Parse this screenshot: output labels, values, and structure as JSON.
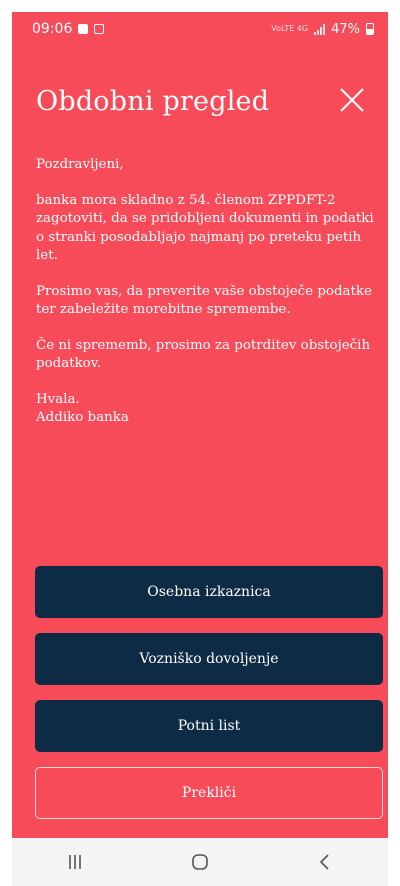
{
  "status_bar": {
    "time": "09:06",
    "network": "VoLTE 4G",
    "battery_percent": "47%"
  },
  "dialog": {
    "title": "Obdobni pregled",
    "paragraphs": [
      "Pozdravljeni,",
      "banka mora skladno z 54. členom ZPPDFT-2 zagotoviti, da se pridobljeni dokumenti in podatki o stranki posodabljajo najmanj po preteku petih let.",
      "Prosimo vas, da preverite vaše obstoječe podatke ter zabeležite morebitne spremembe.",
      "Če ni sprememb, prosimo za potrditev obstoječih podatkov."
    ],
    "closing_line1": "Hvala.",
    "closing_line2": "Addiko banka"
  },
  "buttons": {
    "id_card": "Osebna izkaznica",
    "driving_licence": "Vozniško dovoljenje",
    "passport": "Potni list",
    "cancel": "Prekliči"
  },
  "colors": {
    "background": "#f74b5a",
    "button_dark": "#0d2b45",
    "text": "#ffffff"
  },
  "nav_icons": [
    "recent-apps-icon",
    "home-icon",
    "back-icon"
  ]
}
